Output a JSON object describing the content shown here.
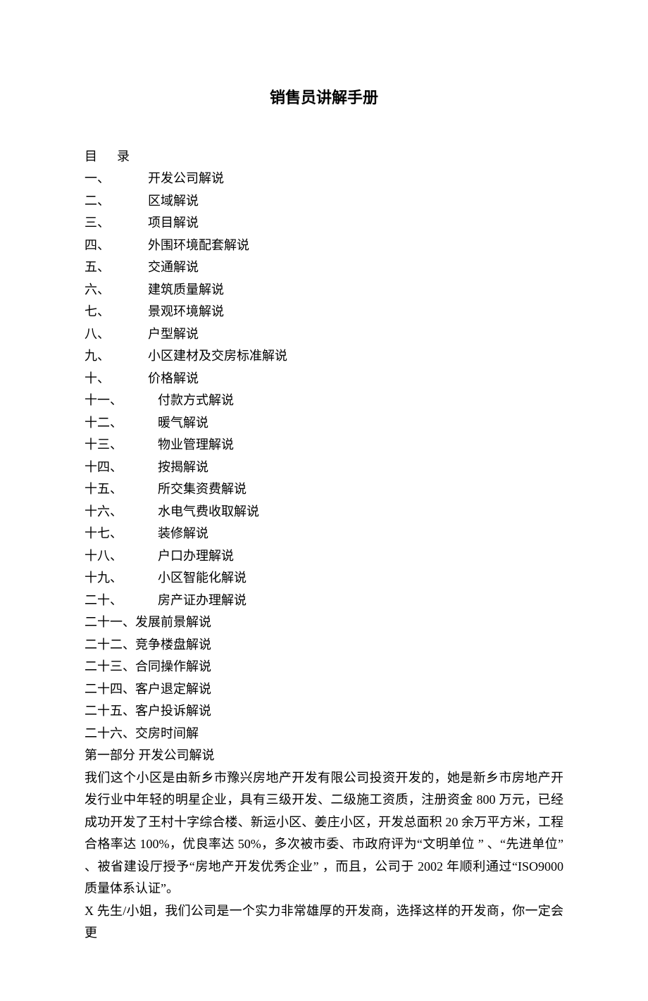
{
  "title": "销售员讲解手册",
  "toc_header_a": "目",
  "toc_header_b": "录",
  "toc": [
    {
      "num": "一、",
      "label": "开发公司解说"
    },
    {
      "num": "二、",
      "label": "区域解说"
    },
    {
      "num": "三、",
      "label": "项目解说"
    },
    {
      "num": "四、",
      "label": "外围环境配套解说"
    },
    {
      "num": "五、",
      "label": "交通解说"
    },
    {
      "num": "六、",
      "label": "建筑质量解说"
    },
    {
      "num": "七、",
      "label": "景观环境解说"
    },
    {
      "num": "八、",
      "label": "户型解说"
    },
    {
      "num": "九、",
      "label": "小区建材及交房标准解说"
    },
    {
      "num": "十、",
      "label": "价格解说"
    },
    {
      "num": "十一、",
      "label": "付款方式解说"
    },
    {
      "num": "十二、",
      "label": "暖气解说"
    },
    {
      "num": "十三、",
      "label": "物业管理解说"
    },
    {
      "num": "十四、",
      "label": "按揭解说"
    },
    {
      "num": "十五、",
      "label": "所交集资费解说"
    },
    {
      "num": "十六、",
      "label": "水电气费收取解说"
    },
    {
      "num": "十七、",
      "label": "装修解说"
    },
    {
      "num": "十八、",
      "label": "户口办理解说"
    },
    {
      "num": "十九、",
      "label": "小区智能化解说"
    },
    {
      "num": "二十、",
      "label": "房产证办理解说"
    }
  ],
  "toc_flat": [
    "二十一、发展前景解说",
    "二十二、竞争楼盘解说",
    "二十三、合同操作解说",
    "二十四、客户退定解说",
    "二十五、客户投诉解说",
    "二十六、交房时间解"
  ],
  "section_heading": "第一部分  开发公司解说",
  "para1": "我们这个小区是由新乡市豫兴房地产开发有限公司投资开发的，她是新乡市房地产开发行业中年轻的明星企业，具有三级开发、二级施工资质，注册资金 800 万元，已经成功开发了王村十字综合楼、新运小区、姜庄小区，开发总面积 20 余万平方米，工程合格率达 100%，优良率达 50%，多次被市委、市政府评为“文明单位 ” 、“先进单位” 、被省建设厅授予“房地产开发优秀企业” ，而且，公司于 2002 年顺利通过“ISO9000 质量体系认证”。",
  "para2": "X 先生/小姐，我们公司是一个实力非常雄厚的开发商，选择这样的开发商，你一定会更"
}
